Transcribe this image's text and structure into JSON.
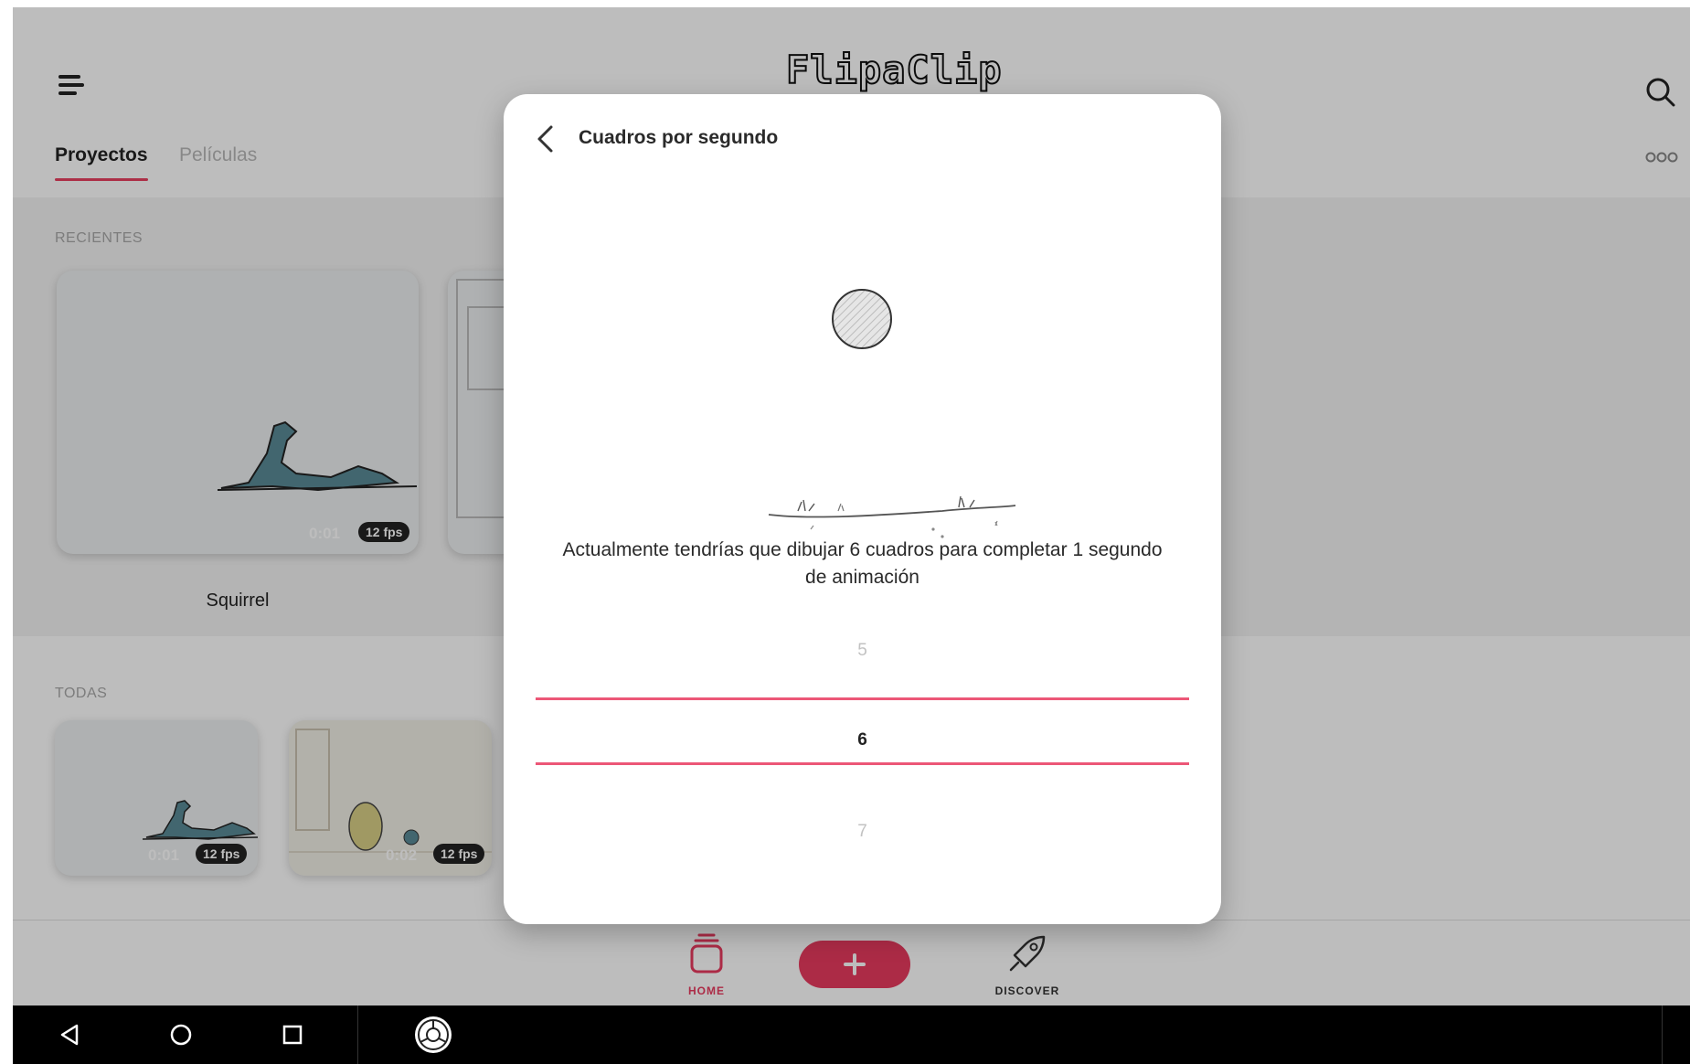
{
  "header": {
    "logo": "FlipaClip",
    "tabs": [
      {
        "label": "Proyectos",
        "active": true
      },
      {
        "label": "Películas",
        "active": false
      }
    ]
  },
  "sections": {
    "recents_label": "RECIENTES",
    "all_label": "TODAS"
  },
  "recent_projects": [
    {
      "title": "Squirrel",
      "duration": "0:01",
      "fps": "12 fps"
    }
  ],
  "all_projects": [
    {
      "duration": "0:01",
      "fps": "12 fps"
    },
    {
      "duration": "0:02",
      "fps": "12 fps"
    }
  ],
  "bottom_nav": {
    "home_label": "HOME",
    "discover_label": "DISCOVER"
  },
  "dialog": {
    "title": "Cuadros por segundo",
    "message": "Actualmente tendrías que dibujar 6 cuadros para completar 1 segundo de animación",
    "picker": {
      "previous": "5",
      "selected": "6",
      "next": "7"
    }
  },
  "colors": {
    "accent": "#e83a5f",
    "picker_line": "#ec5777",
    "text_dark": "#222222",
    "text_faded": "#c2c2c2"
  }
}
